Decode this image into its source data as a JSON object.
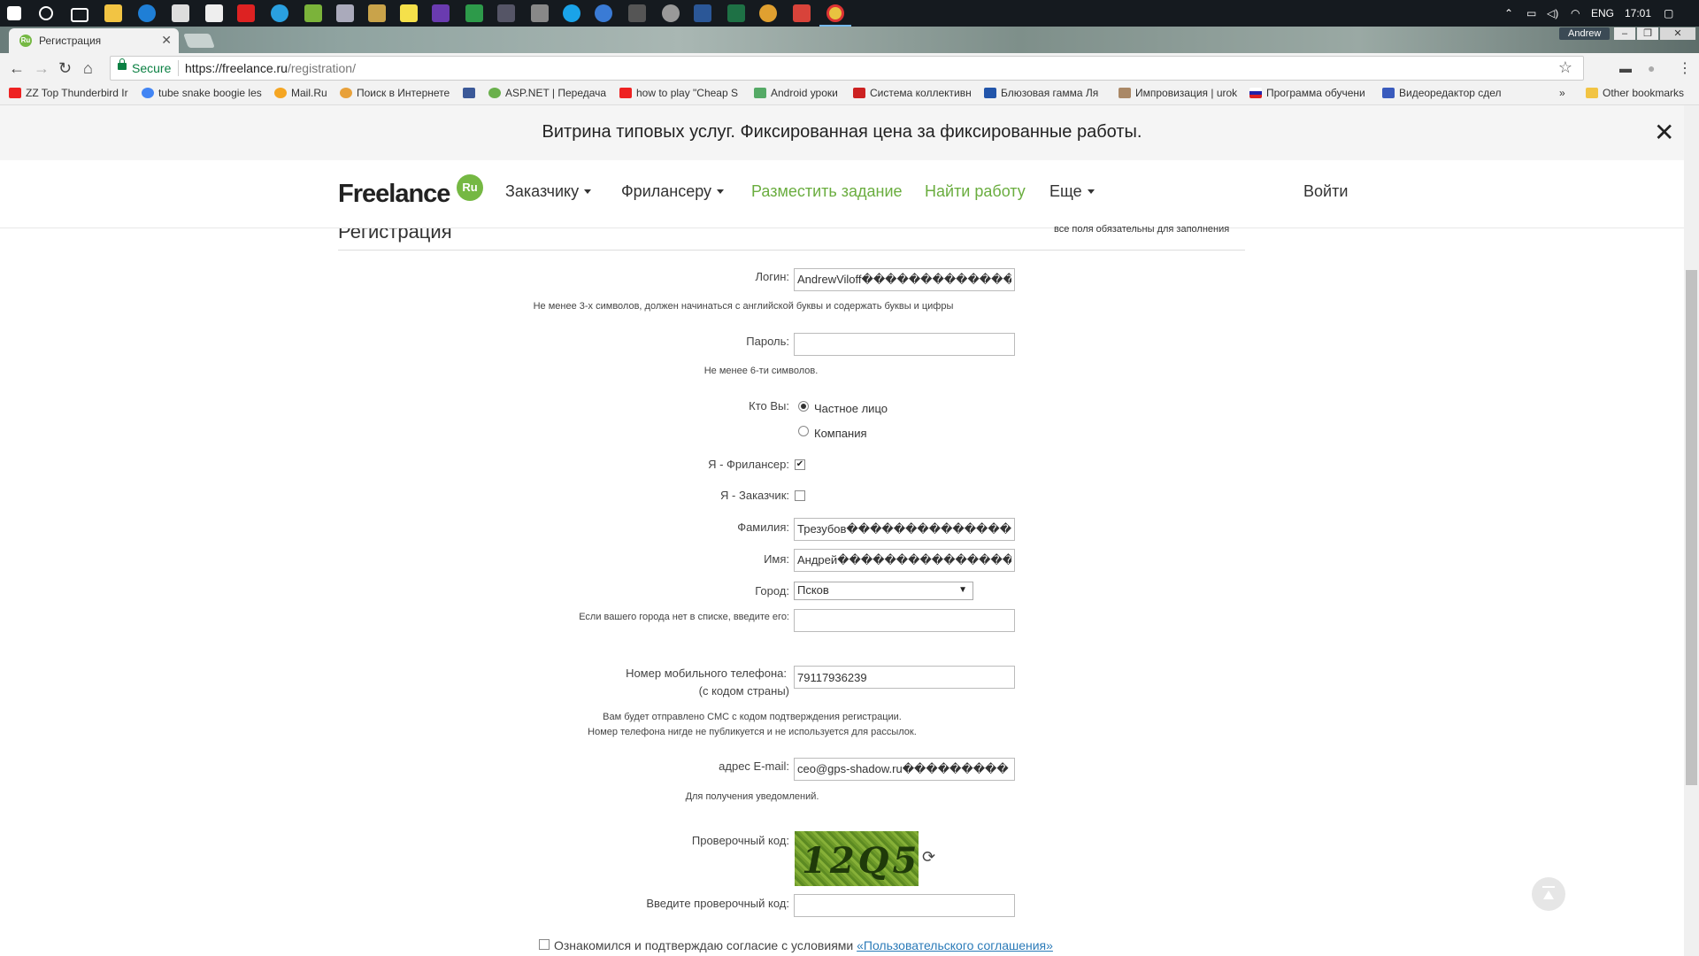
{
  "taskbar": {
    "tray": {
      "lang": "ENG",
      "time": "17:01"
    }
  },
  "browser": {
    "tab_title": "Регистрация",
    "tab_favicon": "Ru",
    "user_badge": "Andrew",
    "secure_label": "Secure",
    "url_host": "https://freelance.ru",
    "url_path": "/registration/",
    "bookmarks": [
      "ZZ Top Thunderbird Ir",
      "tube snake boogie les",
      "Mail.Ru",
      "Поиск в Интернете",
      "ASP.NET | Передача",
      "how to play \"Cheap S",
      "Android уроки",
      "Система коллективн",
      "Блюзовая гамма Ля",
      "Импровизация | urok",
      "Программа обучени",
      "Видеоредактор сдел",
      "Other bookmarks"
    ]
  },
  "banner": {
    "text": "Витрина типовых услуг. Фиксированная цена за фиксированные работы.",
    "close": "✕"
  },
  "header": {
    "logo": "Freelance",
    "logo_badge": "Ru",
    "nav": {
      "customer": "Заказчику",
      "freelancer": "Фрилансеру",
      "post_task": "Разместить задание",
      "find_work": "Найти работу",
      "more": "Еще"
    },
    "login": "Войти"
  },
  "form": {
    "title": "Регистрация",
    "required_note": "все поля обязательны для заполнения",
    "login_label": "Логин:",
    "login_value": "AndrewViloff�������������",
    "login_hint": "Не менее 3-х символов, должен начинаться с английской буквы и содержать буквы и цифры",
    "password_label": "Пароль:",
    "password_hint": "Не менее 6-ти символов.",
    "who_label": "Кто Вы:",
    "who_private": "Частное лицо",
    "who_company": "Компания",
    "freelancer_label": "Я - Фрилансер:",
    "customer_label": "Я - Заказчик:",
    "surname_label": "Фамилия:",
    "surname_value": "Трезубов���������������",
    "name_label": "Имя:",
    "name_value": "Андрей����������������",
    "city_label": "Город:",
    "city_value": "Псков",
    "city_other_label": "Если вашего города нет в списке, введите его:",
    "phone_label": "Номер мобильного телефона:",
    "phone_label_2": "(с кодом страны)",
    "phone_value": "79117936239",
    "phone_hint_1": "Вам будет отправлено СМС с кодом подтверждения регистрации.",
    "phone_hint_2": "Номер телефона нигде не публикуется и не используется для рассылок.",
    "email_label": "адрес E-mail:",
    "email_value": "ceo@gps-shadow.ru���������",
    "email_hint": "Для получения уведомлений.",
    "captcha_label": "Проверочный код:",
    "captcha_text": "12Q5",
    "captcha_input_label": "Введите проверочный код:",
    "agree_text": "Ознакомился и подтверждаю согласие с условиями ",
    "agree_link": "«Пользовательского соглашения»"
  }
}
